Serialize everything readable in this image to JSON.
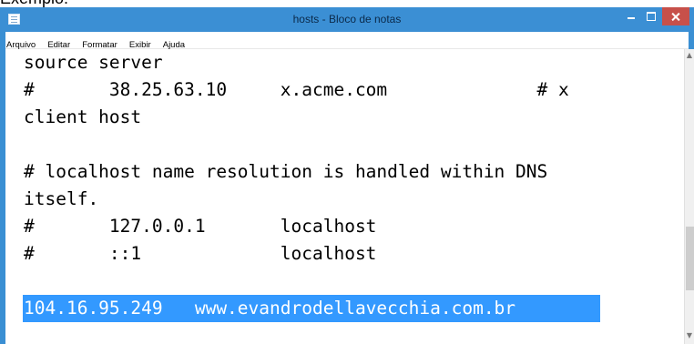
{
  "page_caption_fragment": "Exemplo:",
  "window": {
    "title": "hosts - Bloco de notas"
  },
  "menu": {
    "items": [
      {
        "label": "Arquivo"
      },
      {
        "label": "Editar"
      },
      {
        "label": "Formatar"
      },
      {
        "label": "Exibir"
      },
      {
        "label": "Ajuda"
      }
    ]
  },
  "editor": {
    "lines": [
      "source server",
      "#       38.25.63.10     x.acme.com              # x",
      "client host",
      "",
      "# localhost name resolution is handled within DNS",
      "itself.",
      "#       127.0.0.1       localhost",
      "#       ::1             localhost",
      "",
      "104.16.95.249   www.evandrodellavecchia.com.br"
    ],
    "selected_line_index": 9
  },
  "icons": {
    "app": "notepad-icon",
    "minimize": "minimize-icon",
    "maximize": "maximize-icon",
    "close": "close-icon",
    "scroll_up": "chevron-up-icon",
    "scroll_down": "chevron-down-icon"
  },
  "colors": {
    "titlebar": "#3b8fd4",
    "close_button": "#c7504a",
    "selection": "#3399ff"
  }
}
